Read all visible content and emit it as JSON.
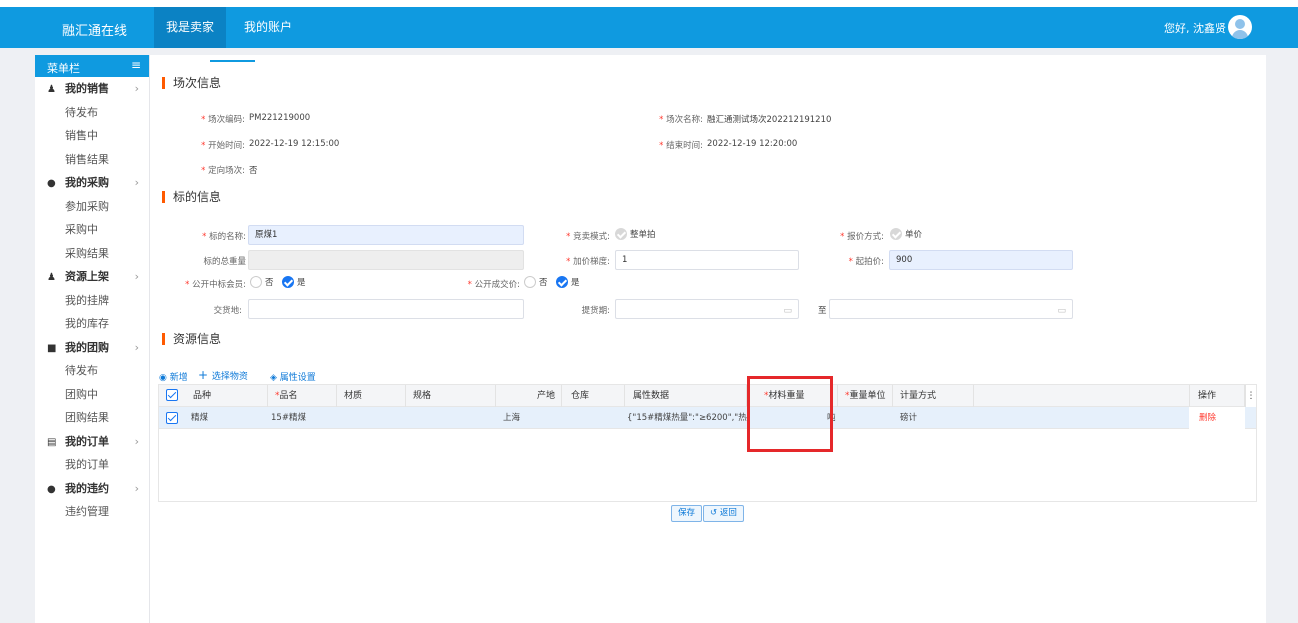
{
  "topnav": {
    "brand": "融汇通在线",
    "tabs": [
      {
        "label": "我是卖家",
        "active": true
      },
      {
        "label": "我的账户",
        "active": false
      }
    ],
    "greeting": "您好, 沈鑫贤"
  },
  "sidebar": {
    "header": "菜单栏",
    "groups": [
      {
        "label": "我的销售",
        "icon": "gavel-icon",
        "items": [
          "待发布",
          "销售中",
          "销售结果"
        ]
      },
      {
        "label": "我的采购",
        "icon": "cart-icon",
        "items": [
          "参加采购",
          "采购中",
          "采购结果"
        ]
      },
      {
        "label": "资源上架",
        "icon": "shelf-icon",
        "items": [
          "我的挂牌",
          "我的库存"
        ]
      },
      {
        "label": "我的团购",
        "icon": "group-icon",
        "items": [
          "待发布",
          "团购中",
          "团购结果"
        ]
      },
      {
        "label": "我的订单",
        "icon": "order-icon",
        "items": [
          "我的订单"
        ]
      },
      {
        "label": "我的违约",
        "icon": "alert-icon",
        "items": [
          "违约管理"
        ]
      }
    ]
  },
  "session": {
    "title": "场次信息",
    "code_label": "场次编码:",
    "code_value": "PM221219000",
    "name_label": "场次名称:",
    "name_value": "融汇通测试场次202212191210",
    "start_label": "开始时间:",
    "start_value": "2022-12-19 12:15:00",
    "end_label": "结束时间:",
    "end_value": "2022-12-19 12:20:00",
    "directed_label": "定向场次:",
    "directed_value": "否"
  },
  "lot": {
    "title": "标的信息",
    "name_label": "标的名称:",
    "name_value": "原煤1",
    "mode_label": "竞卖模式:",
    "mode_value": "整单拍",
    "quote_label": "报价方式:",
    "quote_value": "单价",
    "total_label": "标的总重量",
    "total_value": "",
    "step_label": "加价梯度:",
    "step_value": "1",
    "start_price_label": "起拍价:",
    "start_price_value": "900",
    "public_winner_label": "公开中标会员:",
    "public_price_label": "公开成交价:",
    "no": "否",
    "yes": "是",
    "delivery_label": "交货地:",
    "pickup_label": "提货期:",
    "to_label": "至"
  },
  "resource": {
    "title": "资源信息",
    "add_label": "新增",
    "choose_label": "选择物资",
    "attr_label": "属性设置",
    "columns": [
      "品种",
      "品名",
      "材质",
      "规格",
      "产地",
      "仓库",
      "属性数据",
      "材料重量",
      "重量单位",
      "计量方式",
      "操作"
    ],
    "rows": [
      {
        "variety": "精煤",
        "product": "15#精煤",
        "material": "",
        "spec": "",
        "origin": "上海",
        "warehouse": "",
        "attrs": "{\"15#精煤热量\":\"≥6200\",\"热...",
        "weight": "",
        "unit": "吨",
        "measure": "磅计",
        "action": "删除"
      }
    ]
  },
  "actions": {
    "save": "保存",
    "back": "返回"
  },
  "colors": {
    "brand": "#0f9ae0",
    "accent": "#ff5a00",
    "required": "#ff3b30",
    "highlight": "#e5282a"
  }
}
